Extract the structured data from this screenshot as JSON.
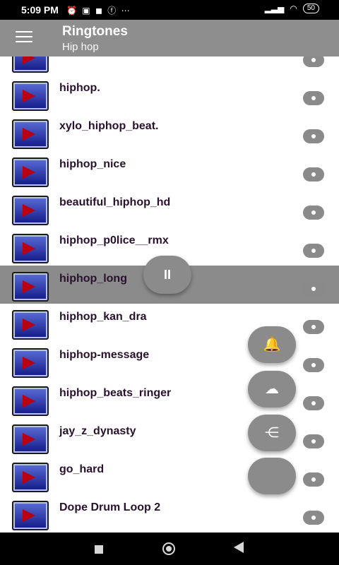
{
  "status_bar": {
    "time": "5:09 PM",
    "battery": "50",
    "left_icons": [
      "alarm-icon",
      "cast-icon",
      "media-icon",
      "facebook-icon",
      "more-icon"
    ],
    "right_icons": [
      "signal-icon",
      "wifi-icon",
      "battery-icon"
    ]
  },
  "app_bar": {
    "title": "Ringtones",
    "subtitle": "Hip hop",
    "background": "#8e8e8e"
  },
  "list": {
    "items": [
      {
        "title": ""
      },
      {
        "title": "hiphop."
      },
      {
        "title": "xylo_hiphop_beat."
      },
      {
        "title": "hiphop_nice"
      },
      {
        "title": "beautiful_hiphop_hd"
      },
      {
        "title": "hiphop_p0lice__rmx"
      },
      {
        "title": "hiphop_long"
      },
      {
        "title": "hiphop_kan_dra"
      },
      {
        "title": "hiphop-message"
      },
      {
        "title": "hiphop_beats_ringer"
      },
      {
        "title": "jay_z_dynasty"
      },
      {
        "title": "go_hard"
      },
      {
        "title": " Dope Drum Loop 2"
      }
    ]
  },
  "floating_controls": {
    "pause": "II",
    "bell": "notification-bell-icon",
    "download": "cloud-download-icon",
    "share": "share-icon"
  },
  "nav_bar": {
    "recent": "recent-apps-icon",
    "home": "home-icon",
    "back": "back-icon"
  }
}
